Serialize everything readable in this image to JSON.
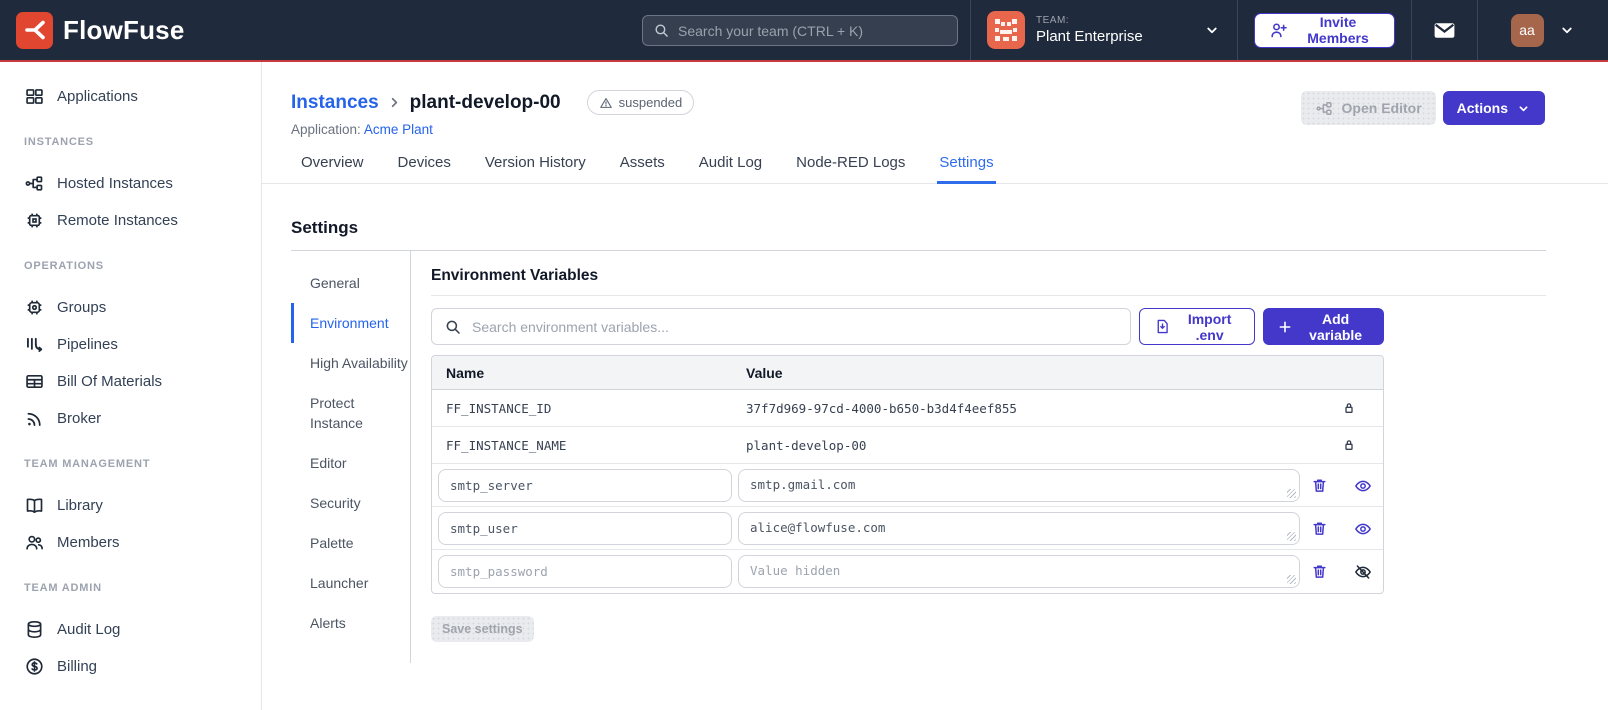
{
  "navbar": {
    "brand": "FlowFuse",
    "search_placeholder": "Search your team (CTRL + K)",
    "team_label": "TEAM:",
    "team_name": "Plant Enterprise",
    "invite_button": "Invite Members",
    "user_initials": "aa"
  },
  "sidebar": {
    "items": [
      {
        "label": "Applications",
        "icon": "applications-icon"
      },
      {
        "label": "Hosted Instances",
        "icon": "hosted-instances-icon"
      },
      {
        "label": "Remote Instances",
        "icon": "remote-instances-icon"
      },
      {
        "label": "Groups",
        "icon": "groups-icon"
      },
      {
        "label": "Pipelines",
        "icon": "pipelines-icon"
      },
      {
        "label": "Bill Of Materials",
        "icon": "bill-of-materials-icon"
      },
      {
        "label": "Broker",
        "icon": "broker-icon"
      },
      {
        "label": "Library",
        "icon": "library-icon"
      },
      {
        "label": "Members",
        "icon": "members-icon"
      },
      {
        "label": "Audit Log",
        "icon": "audit-log-icon"
      },
      {
        "label": "Billing",
        "icon": "billing-icon"
      }
    ],
    "sections": {
      "instances": "INSTANCES",
      "operations": "OPERATIONS",
      "team_management": "TEAM MANAGEMENT",
      "team_admin": "TEAM ADMIN"
    }
  },
  "header": {
    "breadcrumb_root": "Instances",
    "instance_name": "plant-develop-00",
    "status_badge": "suspended",
    "application_label": "Application:",
    "application_name": "Acme Plant",
    "open_editor_button": "Open Editor",
    "actions_button": "Actions"
  },
  "tabs": {
    "items": [
      "Overview",
      "Devices",
      "Version History",
      "Assets",
      "Audit Log",
      "Node-RED Logs",
      "Settings"
    ],
    "active": "Settings"
  },
  "settings": {
    "title": "Settings",
    "nav": [
      "General",
      "Environment",
      "High Availability",
      "Protect Instance",
      "Editor",
      "Security",
      "Palette",
      "Launcher",
      "Alerts"
    ],
    "active": "Environment"
  },
  "env": {
    "title": "Environment Variables",
    "search_placeholder": "Search environment variables...",
    "import_button": "Import .env",
    "add_button": "Add variable",
    "columns": [
      "Name",
      "Value"
    ],
    "locked_rows": [
      {
        "name": "FF_INSTANCE_ID",
        "value": "37f7d969-97cd-4000-b650-b3d4f4eef855"
      },
      {
        "name": "FF_INSTANCE_NAME",
        "value": "plant-develop-00"
      }
    ],
    "editable_rows": [
      {
        "name": "smtp_server",
        "value": "smtp.gmail.com",
        "hidden": false
      },
      {
        "name": "smtp_user",
        "value": "alice@flowfuse.com",
        "hidden": false
      },
      {
        "name": "smtp_password",
        "value": "",
        "value_placeholder": "Value hidden",
        "hidden": true
      }
    ],
    "save_button": "Save settings"
  },
  "colors": {
    "navbar_bg": "#1f2a3c",
    "brand_red": "#e14631",
    "nav_red_line": "#c73a3f",
    "indigo": "#4338ca",
    "link_blue": "#2563eb",
    "active_tab_blue": "#2f6ceb",
    "team_avatar_bg": "#e8664c",
    "user_avatar_bg": "#a5664b"
  }
}
